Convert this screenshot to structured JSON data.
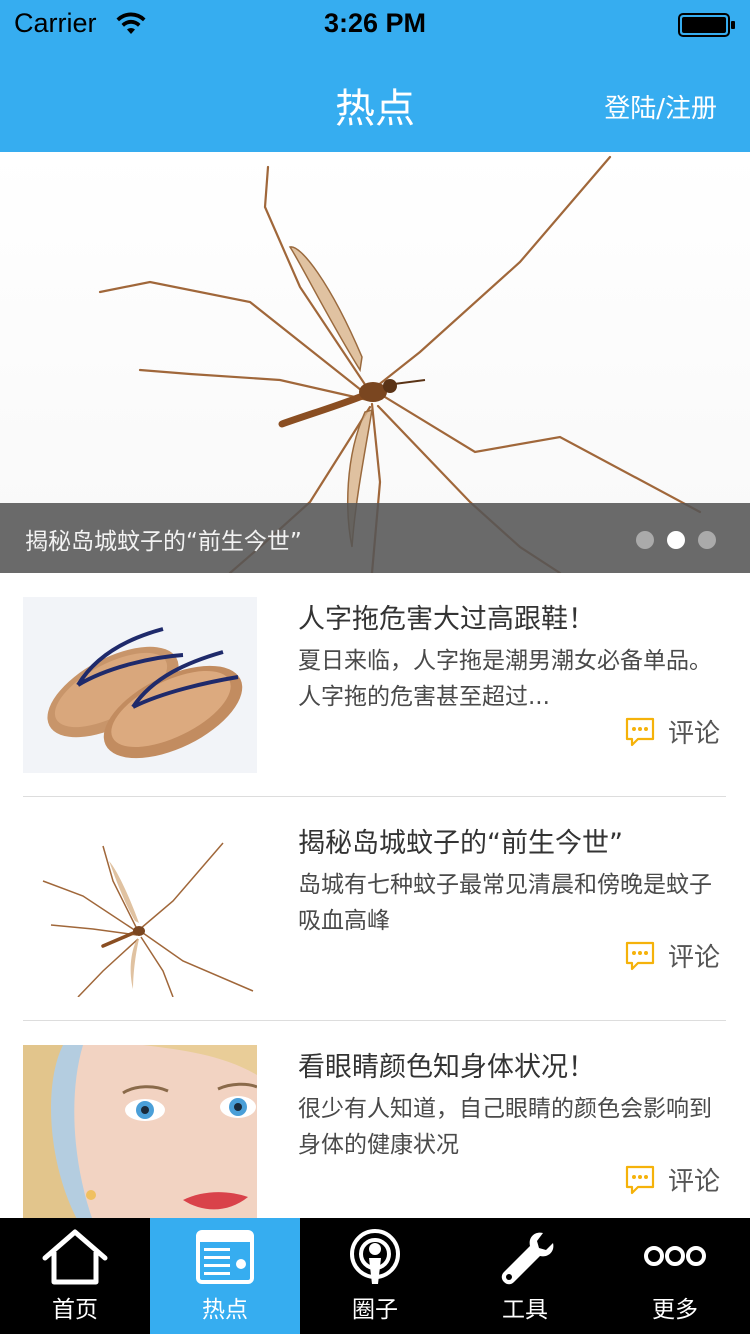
{
  "status_bar": {
    "carrier": "Carrier",
    "time": "3:26 PM"
  },
  "nav": {
    "title": "热点",
    "login_link": "登陆/注册",
    "background_color": "#36adf0"
  },
  "banner": {
    "caption": "揭秘岛城蚊子的“前生今世”",
    "page_count": 3,
    "active_page": 2
  },
  "news": [
    {
      "title": "人字拖危害大过高跟鞋！",
      "desc": "夏日来临，人字拖是潮男潮女必备单品。人字拖的危害甚至超过...",
      "comment_label": "评论",
      "thumb": "sandals-photo"
    },
    {
      "title": "揭秘岛城蚊子的“前生今世”",
      "desc": "岛城有七种蚊子最常见清晨和傍晚是蚊子吸血高峰",
      "comment_label": "评论",
      "thumb": "mosquito-photo"
    },
    {
      "title": "看眼睛颜色知身体状况！",
      "desc": "很少有人知道，自己眼睛的颜色会影响到身体的健康状况",
      "comment_label": "评论",
      "thumb": "woman-face-photo"
    }
  ],
  "tabbar": {
    "tabs": [
      {
        "label": "首页",
        "icon": "home-icon"
      },
      {
        "label": "热点",
        "icon": "news-icon"
      },
      {
        "label": "圈子",
        "icon": "podcast-icon"
      },
      {
        "label": "工具",
        "icon": "wrench-icon"
      },
      {
        "label": "更多",
        "icon": "more-icon"
      }
    ],
    "active_index": 1,
    "accent_color": "#36adf0"
  }
}
